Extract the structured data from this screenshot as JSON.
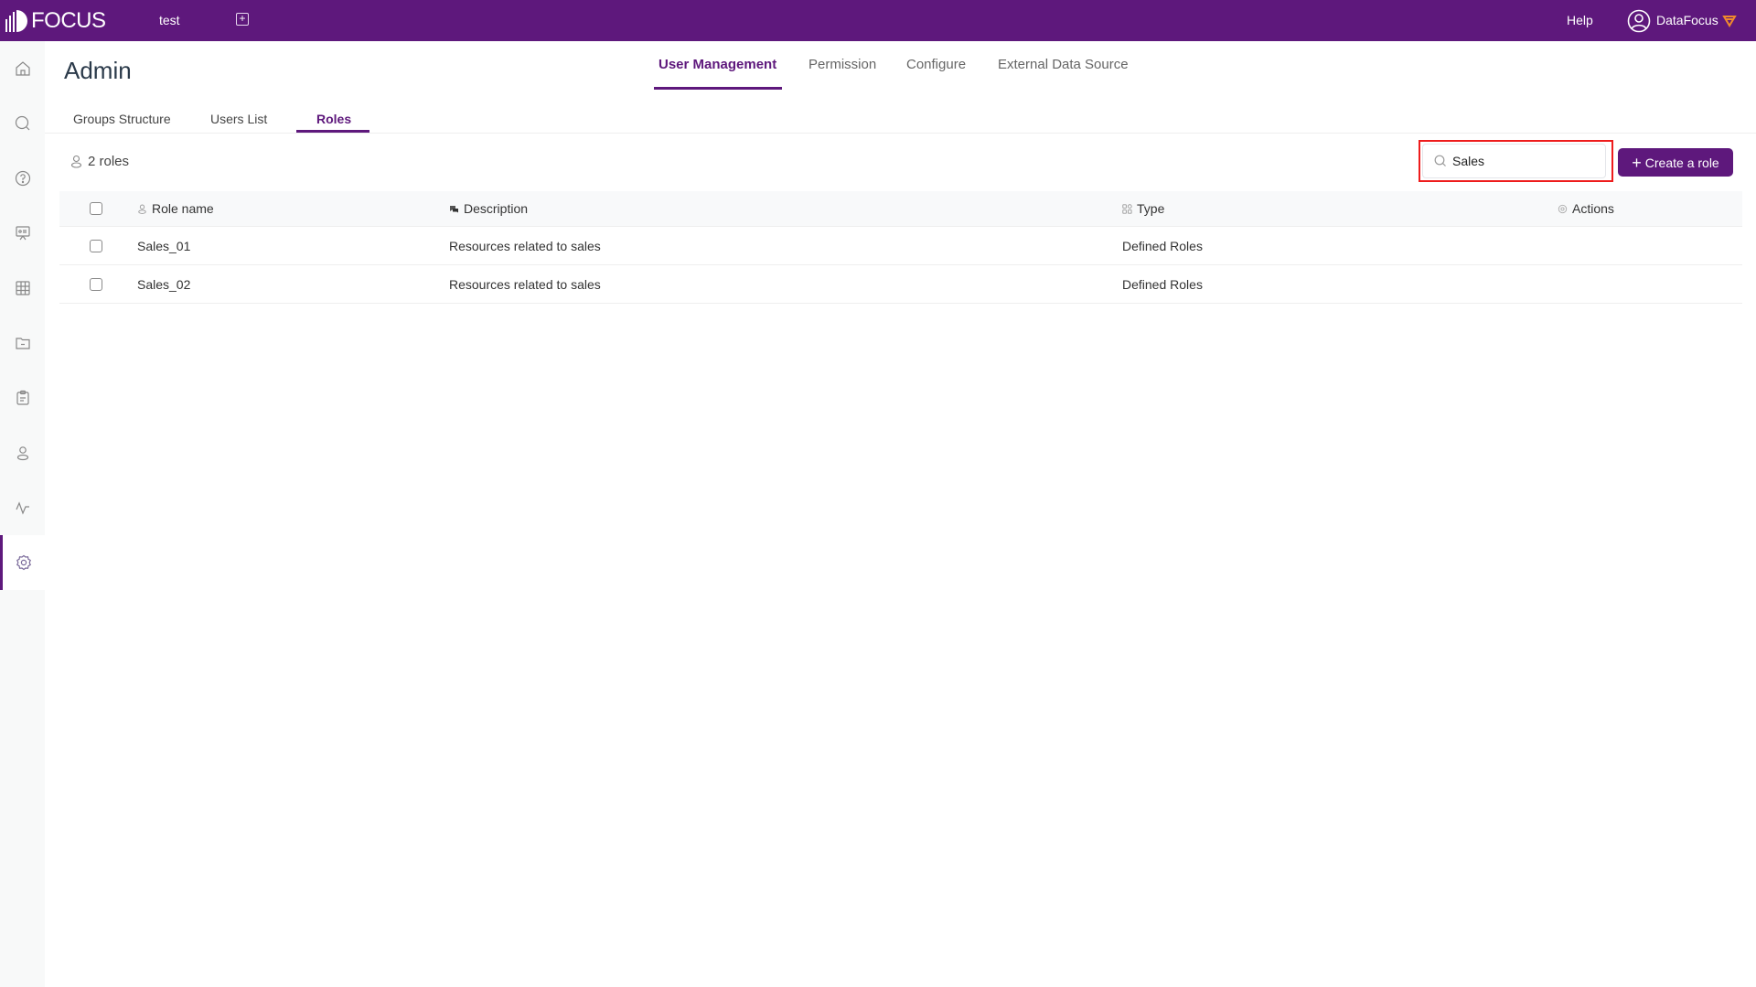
{
  "topbar": {
    "logo_text": "FOCUS",
    "tab_name": "test",
    "add_tab_icon": "plus-square-icon",
    "help_label": "Help",
    "user_icon": "user-circle-icon",
    "user_name": "DataFocus",
    "vip_icon": "diamond-icon",
    "background_color": "#5e187c"
  },
  "sidebar": {
    "items": [
      {
        "name": "home",
        "icon": "home-icon",
        "active": false
      },
      {
        "name": "search",
        "icon": "search-icon",
        "active": false
      },
      {
        "name": "help",
        "icon": "question-circle-icon",
        "active": false
      },
      {
        "name": "presentation",
        "icon": "presentation-board-icon",
        "active": false
      },
      {
        "name": "data",
        "icon": "table-grid-icon",
        "active": false
      },
      {
        "name": "folder",
        "icon": "folder-icon",
        "active": false
      },
      {
        "name": "tasks",
        "icon": "clipboard-icon",
        "active": false
      },
      {
        "name": "users",
        "icon": "user-icon",
        "active": false
      },
      {
        "name": "monitor",
        "icon": "pulse-icon",
        "active": false
      },
      {
        "name": "admin",
        "icon": "gear-icon",
        "active": true
      }
    ]
  },
  "page": {
    "title": "Admin"
  },
  "main_tabs": [
    {
      "label": "User Management",
      "active": true
    },
    {
      "label": "Permission",
      "active": false
    },
    {
      "label": "Configure",
      "active": false
    },
    {
      "label": "External Data Source",
      "active": false
    }
  ],
  "sub_tabs": [
    {
      "label": "Groups Structure",
      "active": false
    },
    {
      "label": "Users List",
      "active": false
    },
    {
      "label": "Roles",
      "active": true
    }
  ],
  "toolbar": {
    "count_label": "2 roles",
    "search_value": "Sales",
    "search_placeholder": "",
    "create_label": "Create a role",
    "accent_color": "#5e187c",
    "highlight_color": "#ee1c1c"
  },
  "table": {
    "columns": [
      {
        "label": "Role name",
        "icon": "user-icon"
      },
      {
        "label": "Description",
        "icon": "chat-icon"
      },
      {
        "label": "Type",
        "icon": "apps-icon"
      },
      {
        "label": "Actions",
        "icon": "gear-icon"
      }
    ],
    "rows": [
      {
        "name": "Sales_01",
        "description": "Resources related to sales",
        "type": "Defined Roles",
        "checked": false
      },
      {
        "name": "Sales_02",
        "description": "Resources related to sales",
        "type": "Defined Roles",
        "checked": false
      }
    ]
  }
}
